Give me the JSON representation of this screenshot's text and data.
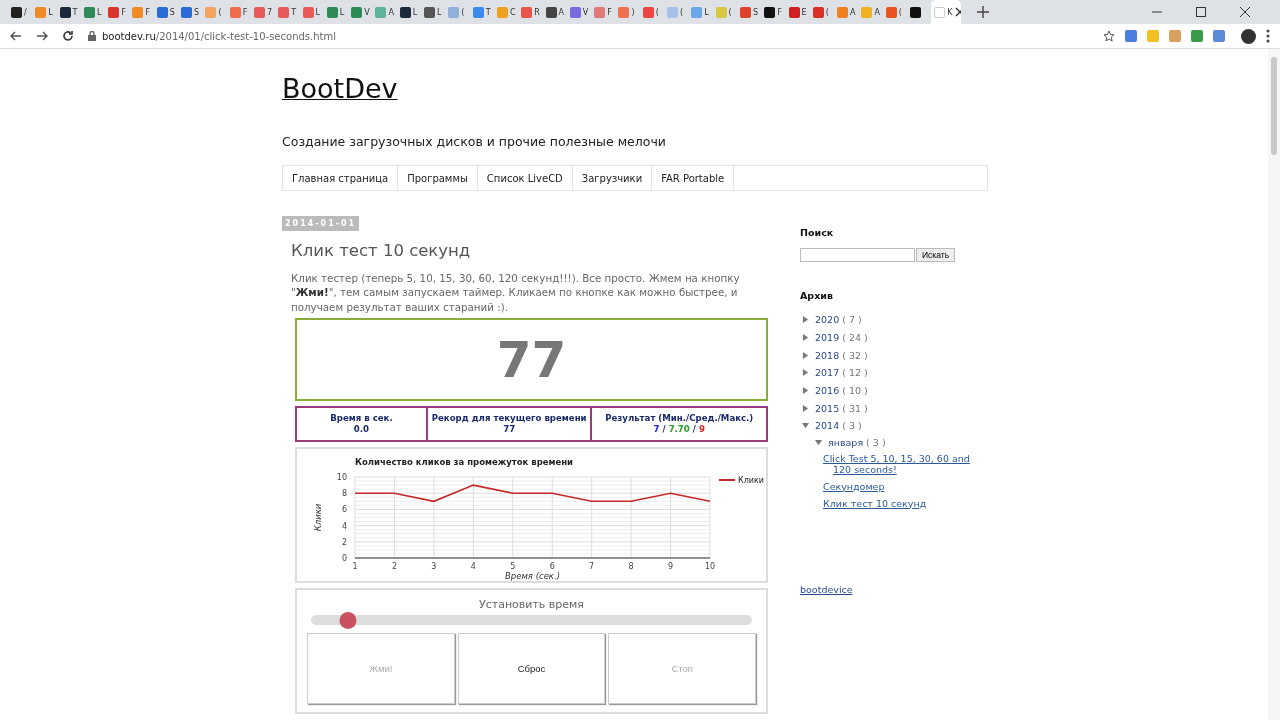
{
  "browser": {
    "tabs": [
      {
        "label": "/",
        "color": "#222222",
        "selected": false
      },
      {
        "label": "L",
        "color": "#f08a24",
        "selected": false
      },
      {
        "label": "T",
        "color": "#1b2a3a",
        "selected": false
      },
      {
        "label": "L",
        "color": "#2e8b57",
        "selected": false
      },
      {
        "label": "F",
        "color": "#d9342b",
        "selected": false
      },
      {
        "label": "F",
        "color": "#f08a24",
        "selected": false
      },
      {
        "label": "S",
        "color": "#2a6ad9",
        "selected": false
      },
      {
        "label": "S",
        "color": "#2a6ad9",
        "selected": false
      },
      {
        "label": "(",
        "color": "#f5a35c",
        "selected": false
      },
      {
        "label": "F",
        "color": "#ef6c4a",
        "selected": false
      },
      {
        "label": "7",
        "color": "#e85a5a",
        "selected": false
      },
      {
        "label": "T",
        "color": "#e85a5a",
        "selected": false
      },
      {
        "label": "L",
        "color": "#e85a5a",
        "selected": false
      },
      {
        "label": "L",
        "color": "#2e8b57",
        "selected": false
      },
      {
        "label": "V",
        "color": "#2e8b57",
        "selected": false
      },
      {
        "label": "A",
        "color": "#5fb39a",
        "selected": false
      },
      {
        "label": "L",
        "color": "#1b2a3a",
        "selected": false
      },
      {
        "label": "L",
        "color": "#555555",
        "selected": false
      },
      {
        "label": "(",
        "color": "#8fb0d9",
        "selected": false
      },
      {
        "label": "T",
        "color": "#3c8af0",
        "selected": false
      },
      {
        "label": "C",
        "color": "#f0a020",
        "selected": false
      },
      {
        "label": "R",
        "color": "#e8534a",
        "selected": false
      },
      {
        "label": "A",
        "color": "#444444",
        "selected": false
      },
      {
        "label": "V",
        "color": "#7a6ae0",
        "selected": false
      },
      {
        "label": "F",
        "color": "#e07a7a",
        "selected": false
      },
      {
        "label": ")",
        "color": "#f07050",
        "selected": false
      },
      {
        "label": "(",
        "color": "#ee4444",
        "selected": false
      },
      {
        "label": "(",
        "color": "#a8c0e8",
        "selected": false
      },
      {
        "label": "L",
        "color": "#6aa6e8",
        "selected": false
      },
      {
        "label": "(",
        "color": "#d8c840",
        "selected": false
      },
      {
        "label": "S",
        "color": "#e0402a",
        "selected": false
      },
      {
        "label": "F",
        "color": "#111111",
        "selected": false
      },
      {
        "label": "E",
        "color": "#d02020",
        "selected": false
      },
      {
        "label": "(",
        "color": "#d93025",
        "selected": false
      },
      {
        "label": "A",
        "color": "#f08020",
        "selected": false
      },
      {
        "label": "A",
        "color": "#f0b020",
        "selected": false
      },
      {
        "label": "(",
        "color": "#e95420",
        "selected": false
      },
      {
        "color": "#111111",
        "selected": false
      },
      {
        "label": "K",
        "color": "#ffffff",
        "selected": true
      }
    ],
    "url_host": "bootdev.ru",
    "url_path": "/2014/01/click-test-10-seconds.html"
  },
  "blog": {
    "title": "BootDev",
    "description": "Создание загрузочных дисков и прочие полезные мелочи",
    "nav": [
      "Главная страница",
      "Программы",
      "Список LiveCD",
      "Загрузчики",
      "FAR Portable"
    ]
  },
  "post": {
    "date": "2014-01-01",
    "title": "Клик тест 10 секунд",
    "intro": "Клик тестер (теперь 5, 10, 15, 30, 60, 120 секунд!!!). Все просто. Жмем на кнопку \"**Жми!**\", тем самым запускаем таймер. Кликаем по кнопке как можно быстрее, и получаем результат ваших стараний :).",
    "counter": "77",
    "stats": [
      {
        "label": "Время в сек.",
        "value": "0.0"
      },
      {
        "label": "Рекорд для текущего времени",
        "value": "77"
      }
    ],
    "result": {
      "label": "Результат (Мин./Сред./Макс.)",
      "parts": [
        {
          "text": "7",
          "color": "#1a1ad0"
        },
        {
          "text": "/"
        },
        {
          "text": "7.70",
          "color": "#2a9a2a"
        },
        {
          "text": "/"
        },
        {
          "text": "9",
          "color": "#e02020"
        }
      ]
    },
    "chart_data": {
      "type": "line",
      "title": "Количество кликов за промежуток времени",
      "xlabel": "Время (сек.)",
      "ylabel": "Клики",
      "x": [
        1,
        2,
        3,
        4,
        5,
        6,
        7,
        8,
        9,
        10
      ],
      "series": [
        {
          "name": "Клики",
          "color": "#c62828",
          "values": [
            8,
            8,
            7,
            9,
            8,
            8,
            7,
            7,
            8,
            7
          ]
        }
      ],
      "xlim": [
        1,
        10
      ],
      "ylim": [
        0,
        10
      ],
      "xticks": [
        1,
        2,
        3,
        4,
        5,
        6,
        7,
        8,
        9,
        10
      ],
      "yticks": [
        0,
        2,
        4,
        6,
        8,
        10
      ],
      "grid": true
    },
    "slider": {
      "label": "Установить время",
      "level": 0.06
    },
    "buttons": [
      {
        "label": "Жми!",
        "disabled": true
      },
      {
        "label": "Сброс",
        "disabled": false
      },
      {
        "label": "Стоп",
        "disabled": true
      }
    ]
  },
  "sidebar": {
    "search": {
      "title": "Поиск",
      "button": "Искать"
    },
    "archive": {
      "title": "Архив",
      "years": [
        {
          "year": "2020",
          "count": "( 7 )",
          "expanded": false
        },
        {
          "year": "2019",
          "count": "( 24 )",
          "expanded": false
        },
        {
          "year": "2018",
          "count": "( 32 )",
          "expanded": false
        },
        {
          "year": "2017",
          "count": "( 12 )",
          "expanded": false
        },
        {
          "year": "2016",
          "count": "( 10 )",
          "expanded": false
        },
        {
          "year": "2015",
          "count": "( 31 )",
          "expanded": false
        },
        {
          "year": "2014",
          "count": "( 3 )",
          "expanded": true,
          "children": [
            {
              "year": "января",
              "count": "( 3 )",
              "expanded": true,
              "posts": [
                "Click Test 5, 10, 15, 30, 60 and 120 seconds!",
                "Секундомер",
                "Клик тест 10 секунд"
              ]
            }
          ]
        }
      ]
    },
    "profile_link": "bootdevice"
  }
}
